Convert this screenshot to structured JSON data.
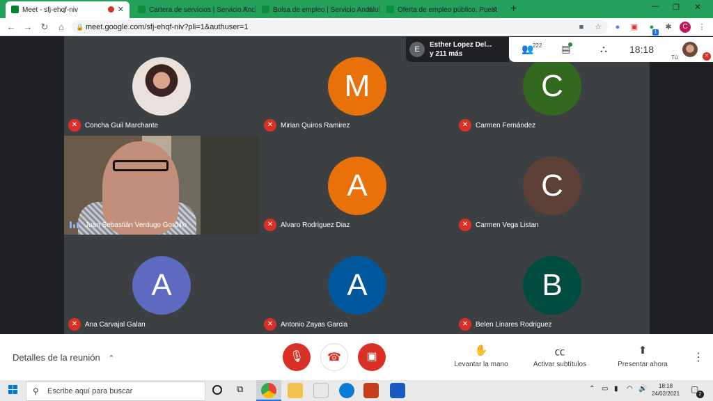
{
  "browser": {
    "tabs": [
      {
        "title": "Meet - sfj-ehqf-niv",
        "icon": "meet-icon"
      },
      {
        "title": "Cartera de servicios | Servicio And",
        "icon": "junta-icon"
      },
      {
        "title": "Bolsa de empleo | Servicio Andalu",
        "icon": "junta-icon"
      },
      {
        "title": "Oferta de empleo público. Puest",
        "icon": "junta-icon"
      }
    ],
    "url": "meet.google.com/sfj-ehqf-niv?pli=1&authuser=1",
    "profile_letter": "C",
    "extension_badge": "1"
  },
  "meet": {
    "participant_count": "222",
    "people_preview": {
      "avatar_letter": "E",
      "line1": "Esther Lopez Del...",
      "line2": "y 211 más"
    },
    "clock": "18:18",
    "self_label": "Tú",
    "participants": [
      {
        "name": "Concha Guil Marchante",
        "type": "photo",
        "muted": true
      },
      {
        "name": "Mirian Quiros Ramirez",
        "initial": "M",
        "color": "#e8710a",
        "muted": true
      },
      {
        "name": "Carmen Fernández",
        "initial": "C",
        "color": "#33691e",
        "muted": true
      },
      {
        "name": "Juan Sebastián Verdugo Gordillo",
        "type": "video",
        "muted": false
      },
      {
        "name": "Alvaro Rodriguez Diaz",
        "initial": "A",
        "color": "#e8710a",
        "muted": true
      },
      {
        "name": "Carmen Vega Listan",
        "initial": "C",
        "color": "#5d4037",
        "muted": true
      },
      {
        "name": "Ana Carvajal Galan",
        "initial": "A",
        "color": "#5c6bc0",
        "muted": true
      },
      {
        "name": "Antonio Zayas Garcia",
        "initial": "A",
        "color": "#01579b",
        "muted": true
      },
      {
        "name": "Belen Linares Rodriguez",
        "initial": "B",
        "color": "#004d40",
        "muted": true
      }
    ],
    "bottom": {
      "details_label": "Detalles de la reunión",
      "raise_hand": "Levantar la mano",
      "captions": "Activar subtítulos",
      "present": "Presentar ahora"
    }
  },
  "taskbar": {
    "search_placeholder": "Escribe aquí para buscar",
    "time": "18:18",
    "date": "24/02/2021",
    "notifications": "2"
  }
}
